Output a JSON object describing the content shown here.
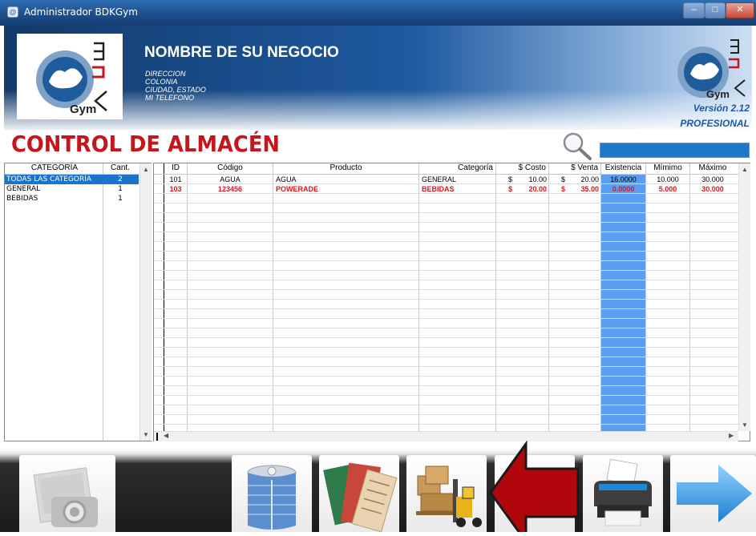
{
  "window": {
    "title": "Administrador BDKGym",
    "minimize": "–",
    "maximize": "□",
    "close": "✕"
  },
  "header": {
    "business_name": "NOMBRE DE SU NEGOCIO",
    "address_lines": [
      "DIRECCION",
      "COLONIA",
      "CIUDAD, ESTADO",
      "MI TELEFONO"
    ],
    "logo_text": "Gym",
    "version": "Versión 2.12",
    "edition": "PROFESIONAL"
  },
  "section_title": "CONTROL DE ALMACÉN",
  "search": {
    "value": "",
    "icon": "search-icon"
  },
  "categories": {
    "headers": [
      "CATEGORÍA",
      "Cant."
    ],
    "rows": [
      {
        "name": "TODAS LAS CATEGORÍA",
        "count": "2",
        "selected": true
      },
      {
        "name": "GENERAL",
        "count": "1",
        "selected": false
      },
      {
        "name": "BEBIDAS",
        "count": "1",
        "selected": false
      }
    ]
  },
  "products": {
    "headers": [
      "ID",
      "Código",
      "Producto",
      "Categoría",
      "$ Costo",
      "$ Venta",
      "Existencia",
      "Mímimo",
      "Máximo"
    ],
    "rows": [
      {
        "id": "101",
        "code": "AGUA",
        "product": "AGUA",
        "category": "GENERAL",
        "cost_sign": "$",
        "cost": "10.00",
        "sale_sign": "$",
        "sale": "20.00",
        "stock": "16.0000",
        "min": "10.000",
        "max": "30.000",
        "alert": false
      },
      {
        "id": "103",
        "code": "123456",
        "product": "POWERADE",
        "category": "BEBIDAS",
        "cost_sign": "$",
        "cost": "20.00",
        "sale_sign": "$",
        "sale": "35.00",
        "stock": "0.0000",
        "min": "5.000",
        "max": "30.000",
        "alert": true
      }
    ]
  },
  "toolbar": {
    "buttons": [
      "photo-button",
      "supplier-building-button",
      "labels-button",
      "inventory-forklift-button",
      "highlighted-button",
      "print-button",
      "next-arrow-button"
    ]
  },
  "colors": {
    "accent_red": "#c4161c",
    "highlight_blue": "#1c78c8",
    "stock_column": "#5b9ef0",
    "alert_red": "#e0141e"
  }
}
